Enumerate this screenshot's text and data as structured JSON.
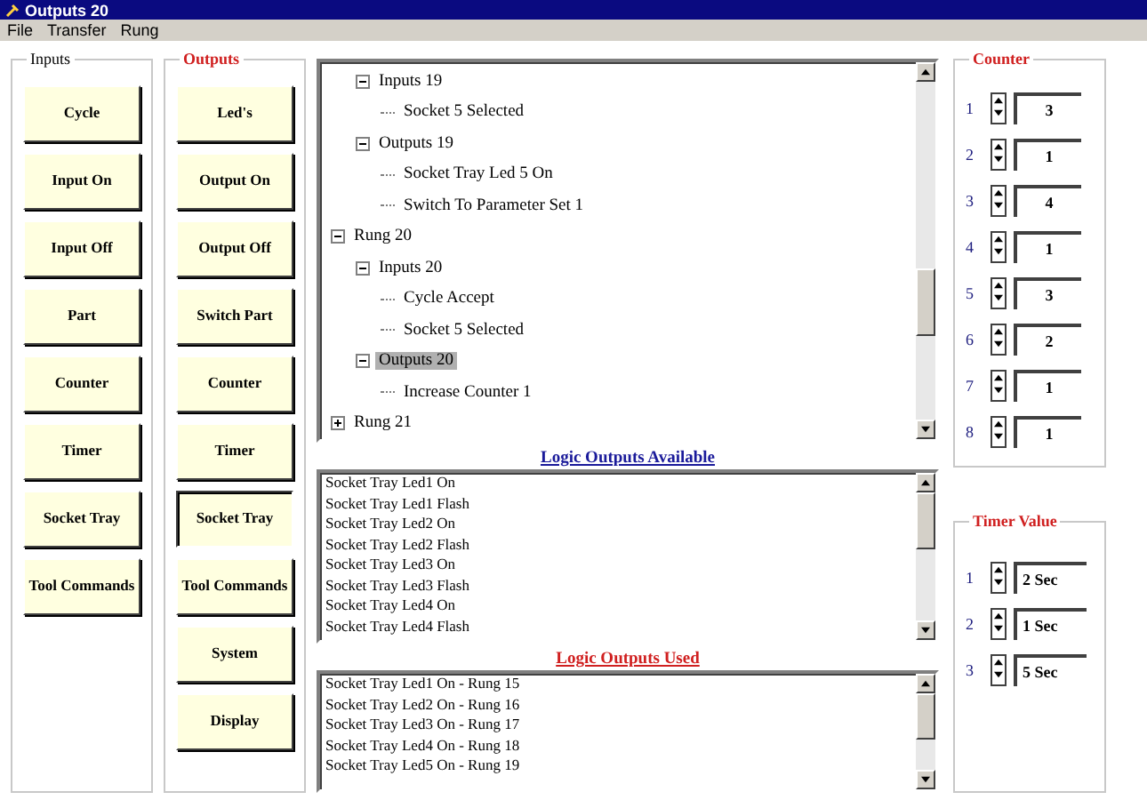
{
  "window": {
    "title": "Outputs 20"
  },
  "menu": [
    "File",
    "Transfer",
    "Rung"
  ],
  "inputs": {
    "title": "Inputs",
    "buttons": [
      {
        "label": "Cycle",
        "selected": false
      },
      {
        "label": "Input On",
        "selected": false
      },
      {
        "label": "Input Off",
        "selected": false
      },
      {
        "label": "Part",
        "selected": false
      },
      {
        "label": "Counter",
        "selected": false
      },
      {
        "label": "Timer",
        "selected": false
      },
      {
        "label": "Socket Tray",
        "selected": false
      },
      {
        "label": "Tool Commands",
        "selected": false
      }
    ]
  },
  "outputs": {
    "title": "Outputs",
    "buttons": [
      {
        "label": "Led's",
        "selected": false
      },
      {
        "label": "Output On",
        "selected": false
      },
      {
        "label": "Output Off",
        "selected": false
      },
      {
        "label": "Switch Part",
        "selected": false
      },
      {
        "label": "Counter",
        "selected": false
      },
      {
        "label": "Timer",
        "selected": false
      },
      {
        "label": "Socket Tray",
        "selected": true
      },
      {
        "label": "Tool Commands",
        "selected": false
      },
      {
        "label": "System",
        "selected": false
      },
      {
        "label": "Display",
        "selected": false
      }
    ]
  },
  "tree": {
    "items": [
      {
        "kind": "group",
        "label": "Inputs 19",
        "selected": false,
        "expanded": true,
        "children": [
          {
            "label": "Socket 5 Selected",
            "selected": false
          }
        ]
      },
      {
        "kind": "group",
        "label": "Outputs 19",
        "selected": false,
        "expanded": true,
        "children": [
          {
            "label": "Socket Tray Led 5 On",
            "selected": false
          },
          {
            "label": "Switch To Parameter Set 1",
            "selected": false
          }
        ]
      },
      {
        "kind": "rung",
        "label": "Rung 20",
        "selected": false,
        "expanded": true,
        "children": [
          {
            "label": "Inputs 20",
            "selected": false,
            "expanded": true,
            "children": [
              {
                "label": "Cycle Accept",
                "selected": false
              },
              {
                "label": "Socket 5 Selected",
                "selected": false
              }
            ]
          },
          {
            "label": "Outputs 20",
            "selected": true,
            "expanded": true,
            "children": [
              {
                "label": "Increase Counter 1",
                "selected": false
              }
            ]
          }
        ]
      },
      {
        "kind": "rung",
        "label": "Rung 21",
        "selected": false,
        "expanded": false
      }
    ]
  },
  "available": {
    "title": "Logic Outputs Available",
    "items": [
      "Socket Tray Led1 On",
      "Socket Tray Led1 Flash",
      "Socket Tray Led2 On",
      "Socket Tray Led2 Flash",
      "Socket Tray Led3 On",
      "Socket Tray Led3 Flash",
      "Socket Tray Led4 On",
      "Socket Tray Led4 Flash"
    ]
  },
  "used": {
    "title": "Logic Outputs Used",
    "items": [
      "Socket Tray Led1 On - Rung 15",
      "Socket Tray Led2 On - Rung 16",
      "Socket Tray Led3 On - Rung 17",
      "Socket Tray Led4 On - Rung 18",
      "Socket Tray Led5 On - Rung 19"
    ]
  },
  "counter": {
    "title": "Counter",
    "rows": [
      {
        "label": "1",
        "value": "3"
      },
      {
        "label": "2",
        "value": "1"
      },
      {
        "label": "3",
        "value": "4"
      },
      {
        "label": "4",
        "value": "1"
      },
      {
        "label": "5",
        "value": "3"
      },
      {
        "label": "6",
        "value": "2"
      },
      {
        "label": "7",
        "value": "1"
      },
      {
        "label": "8",
        "value": "1"
      }
    ]
  },
  "timer": {
    "title": "Timer Value",
    "rows": [
      {
        "label": "1",
        "value": "2 Sec"
      },
      {
        "label": "2",
        "value": "1 Sec"
      },
      {
        "label": "3",
        "value": "5 Sec"
      }
    ]
  }
}
